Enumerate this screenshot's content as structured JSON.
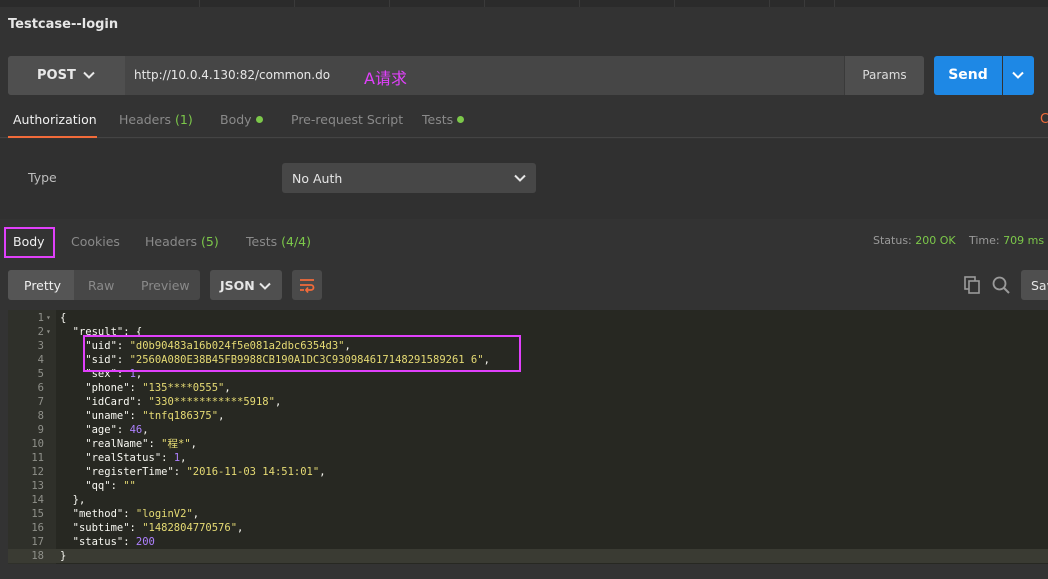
{
  "window": {
    "title": "Testcase--login"
  },
  "request": {
    "method": "POST",
    "url": "http://10.0.4.130:82/common.do",
    "annotation": "A请求",
    "params_label": "Params",
    "send_label": "Send"
  },
  "request_tabs": [
    {
      "label": "Authorization",
      "active": true
    },
    {
      "label": "Headers",
      "count": "(1)"
    },
    {
      "label": "Body",
      "dot": true
    },
    {
      "label": "Pre-request Script"
    },
    {
      "label": "Tests",
      "dot": true
    }
  ],
  "auth": {
    "type_label": "Type",
    "type_value": "No Auth"
  },
  "response_tabs": [
    {
      "label": "Body",
      "active": true
    },
    {
      "label": "Cookies"
    },
    {
      "label": "Headers",
      "count": "(5)"
    },
    {
      "label": "Tests",
      "count": "(4/4)"
    }
  ],
  "status": {
    "label": "Status:",
    "value": "200 OK",
    "time_label": "Time:",
    "time_value": "709 ms"
  },
  "view": {
    "pretty": "Pretty",
    "raw": "Raw",
    "preview": "Preview",
    "format": "JSON",
    "save": "Sav"
  },
  "code": {
    "lines": [
      {
        "n": "1",
        "fold": true,
        "parts": [
          [
            "p",
            "{"
          ]
        ]
      },
      {
        "n": "2",
        "fold": true,
        "parts": [
          [
            "k",
            "  \"result\""
          ],
          [
            "p",
            ": {"
          ]
        ]
      },
      {
        "n": "3",
        "parts": [
          [
            "k",
            "    \"uid\""
          ],
          [
            "p",
            ": "
          ],
          [
            "s",
            "\"d0b90483a16b024f5e081a2dbc6354d3\""
          ],
          [
            "p",
            ","
          ]
        ]
      },
      {
        "n": "4",
        "parts": [
          [
            "k",
            "    \"sid\""
          ],
          [
            "p",
            ": "
          ],
          [
            "s",
            "\"2560A080E38B45FB9988CB190A1DC3C930984617148291589261 6\""
          ],
          [
            "p",
            ","
          ]
        ]
      },
      {
        "n": "5",
        "parts": [
          [
            "k",
            "    \"sex\""
          ],
          [
            "p",
            ": "
          ],
          [
            "n",
            "1"
          ],
          [
            "p",
            ","
          ]
        ]
      },
      {
        "n": "6",
        "parts": [
          [
            "k",
            "    \"phone\""
          ],
          [
            "p",
            ": "
          ],
          [
            "s",
            "\"135****0555\""
          ],
          [
            "p",
            ","
          ]
        ]
      },
      {
        "n": "7",
        "parts": [
          [
            "k",
            "    \"idCard\""
          ],
          [
            "p",
            ": "
          ],
          [
            "s",
            "\"330***********5918\""
          ],
          [
            "p",
            ","
          ]
        ]
      },
      {
        "n": "8",
        "parts": [
          [
            "k",
            "    \"uname\""
          ],
          [
            "p",
            ": "
          ],
          [
            "s",
            "\"tnfq186375\""
          ],
          [
            "p",
            ","
          ]
        ]
      },
      {
        "n": "9",
        "parts": [
          [
            "k",
            "    \"age\""
          ],
          [
            "p",
            ": "
          ],
          [
            "n",
            "46"
          ],
          [
            "p",
            ","
          ]
        ]
      },
      {
        "n": "10",
        "parts": [
          [
            "k",
            "    \"realName\""
          ],
          [
            "p",
            ": "
          ],
          [
            "s",
            "\"程*\""
          ],
          [
            "p",
            ","
          ]
        ]
      },
      {
        "n": "11",
        "parts": [
          [
            "k",
            "    \"realStatus\""
          ],
          [
            "p",
            ": "
          ],
          [
            "n",
            "1"
          ],
          [
            "p",
            ","
          ]
        ]
      },
      {
        "n": "12",
        "parts": [
          [
            "k",
            "    \"registerTime\""
          ],
          [
            "p",
            ": "
          ],
          [
            "s",
            "\"2016-11-03 14:51:01\""
          ],
          [
            "p",
            ","
          ]
        ]
      },
      {
        "n": "13",
        "parts": [
          [
            "k",
            "    \"qq\""
          ],
          [
            "p",
            ": "
          ],
          [
            "s",
            "\"\""
          ]
        ]
      },
      {
        "n": "14",
        "parts": [
          [
            "p",
            "  },"
          ]
        ]
      },
      {
        "n": "15",
        "parts": [
          [
            "k",
            "  \"method\""
          ],
          [
            "p",
            ": "
          ],
          [
            "s",
            "\"loginV2\""
          ],
          [
            "p",
            ","
          ]
        ]
      },
      {
        "n": "16",
        "parts": [
          [
            "k",
            "  \"subtime\""
          ],
          [
            "p",
            ": "
          ],
          [
            "s",
            "\"1482804770576\""
          ],
          [
            "p",
            ","
          ]
        ]
      },
      {
        "n": "17",
        "parts": [
          [
            "k",
            "  \"status\""
          ],
          [
            "p",
            ": "
          ],
          [
            "n",
            "200"
          ]
        ]
      },
      {
        "n": "18",
        "current": true,
        "parts": [
          [
            "p",
            "}"
          ]
        ]
      }
    ]
  },
  "colors": {
    "accent": "#f26b3a",
    "send": "#1e88e5",
    "highlight": "#e040fb",
    "ok": "#7cc84a"
  }
}
